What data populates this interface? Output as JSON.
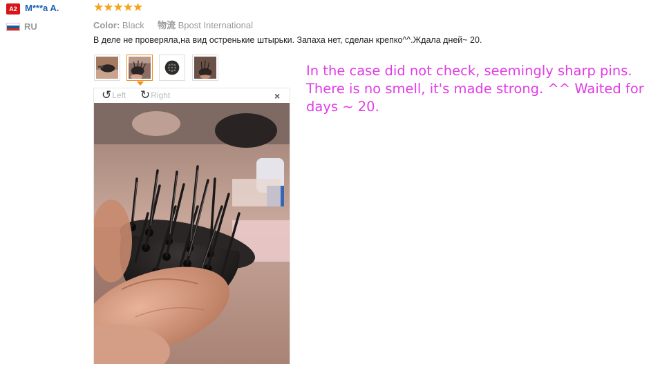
{
  "reviewer": {
    "badge": "A2",
    "name": "M***a A.",
    "country": "RU",
    "flag_colors": [
      "#ffffff",
      "#1c57a5",
      "#d52b1e"
    ]
  },
  "review": {
    "rating": 5,
    "stars_text": "★★★★★",
    "color_label": "Color:",
    "color_value": "Black",
    "shipping_label": "物流",
    "shipping_value": "Bpost International",
    "text": "В деле не проверяла,на вид остренькие штырьки. Запаха нет, сделан крепко^^.Ждала дней~ 20."
  },
  "thumbnails": [
    {
      "name": "thumb-1",
      "active": false
    },
    {
      "name": "thumb-2",
      "active": true
    },
    {
      "name": "thumb-3",
      "active": false
    },
    {
      "name": "thumb-4",
      "active": false
    }
  ],
  "viewer": {
    "rotate_left_label": "Left",
    "rotate_right_label": "Right",
    "close_symbol": "×",
    "rotate_left_icon": "↺",
    "rotate_right_icon": "↻"
  },
  "translation": "In the case did not check, seemingly sharp pins. There is no smell, it's made strong. ^^ Waited for days ~ 20.",
  "colors": {
    "accent_orange": "#f08a1c",
    "star": "#f5a31a",
    "name_blue": "#1d5fb3",
    "translation_magenta": "#e23be6",
    "badge_red": "#d7141a"
  }
}
